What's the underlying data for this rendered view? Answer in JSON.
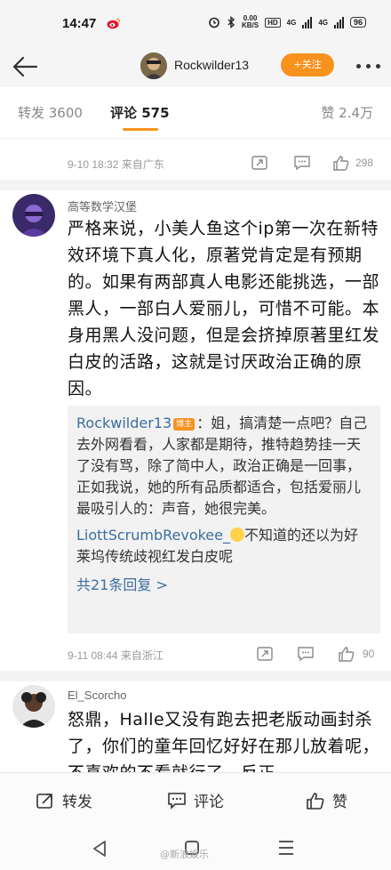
{
  "status_bar": {
    "time": "14:47",
    "net_speed_top": "0.00",
    "net_speed_bottom": "KB/S",
    "hd": "HD",
    "net1": "4G",
    "net2": "4G",
    "battery": "96"
  },
  "nav": {
    "username": "Rockwilder13",
    "follow_label": "+关注"
  },
  "tabs": {
    "repost": "转发 3600",
    "comment": "评论 575",
    "like": "赞 2.4万"
  },
  "comments": [
    {
      "meta": "9-10 18:32 来自广东",
      "likes": "298"
    },
    {
      "username": "高等数学汉堡",
      "text": "严格来说，小美人鱼这个ip第一次在新特效环境下真人化，原著党肯定是有预期的。如果有两部真人电影还能挑选，一部黑人，一部白人爱丽儿，可惜不可能。本身用黑人没问题，但是会挤掉原著里红发白皮的活路，这就是讨厌政治正确的原因。",
      "replies": [
        {
          "user": "Rockwilder13",
          "badge": "博主",
          "text": "：姐，搞清楚一点吧？自己去外网看看，人家都是期待，推特趋势挂一天了没有骂，除了简中人，政治正确是一回事，正如我说，她的所有品质都适合，包括爱丽儿最吸引人的：声音，她很完美。"
        },
        {
          "user": "LiottScrumbRevokee_",
          "text": "不知道的还以为好莱坞传统歧视红发白皮呢"
        }
      ],
      "more_replies": "共21条回复 >",
      "meta": "9-11 08:44 来自浙江",
      "likes": "90"
    },
    {
      "username": "El_Scorcho",
      "text": "怒鼎，Halle又没有跑去把老版动画封杀了，你们的童年回忆好好在那儿放着呢，不喜欢的不看就行了。反正"
    }
  ],
  "action_bar": {
    "repost": "转发",
    "comment": "评论",
    "like": "赞"
  },
  "watermark": "@新浪娱乐"
}
